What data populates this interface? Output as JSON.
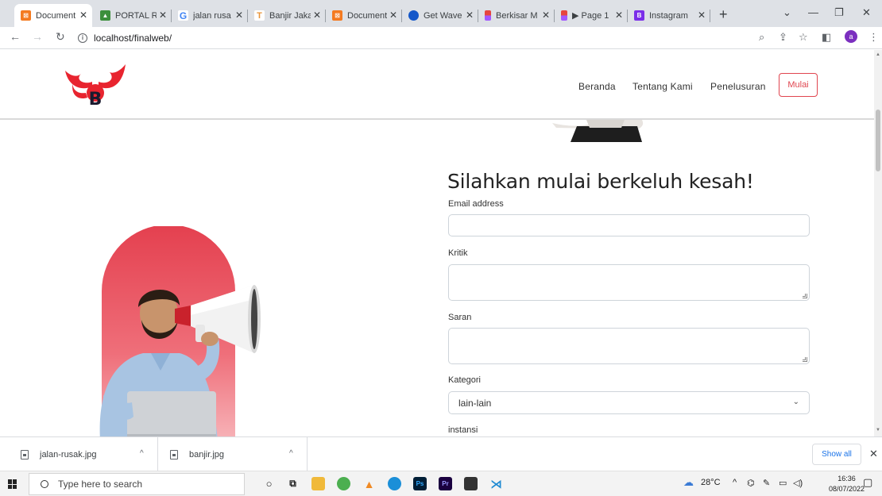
{
  "browser": {
    "tabs": [
      {
        "title": "Document",
        "icon": "xampp-icon",
        "color": "#f47a20",
        "active": true
      },
      {
        "title": "PORTAL R",
        "icon": "portal-icon",
        "color": "#3c8f3c"
      },
      {
        "title": "jalan rusa",
        "icon": "google-icon",
        "color": "#4285f4"
      },
      {
        "title": "Banjir Jaka",
        "icon": "t-icon",
        "color": "#e9953a"
      },
      {
        "title": "Document",
        "icon": "xampp-icon",
        "color": "#f47a20"
      },
      {
        "title": "Get Wave",
        "icon": "wave-icon",
        "color": "#1457c9"
      },
      {
        "title": "Berkisar M",
        "icon": "figma-icon",
        "color": "#e6463e"
      },
      {
        "title": "▶ Page 1",
        "icon": "figma-icon",
        "color": "#e6463e"
      },
      {
        "title": "Instagram",
        "icon": "bootstrap-icon",
        "color": "#7b2ee9"
      }
    ],
    "address": "localhost/finalweb/",
    "profile_initial": "a"
  },
  "site": {
    "nav": {
      "items": [
        "Beranda",
        "Tentang Kami",
        "Penelusuran"
      ],
      "cta": "Mulai"
    },
    "accent_color": "#e0454f",
    "form": {
      "title": "Silahkan mulai berkeluh kesah!",
      "email_label": "Email address",
      "kritik_label": "Kritik",
      "saran_label": "Saran",
      "kategori_label": "Kategori",
      "kategori_value": "lain-lain",
      "instansi_label": "instansi"
    }
  },
  "downloads": {
    "items": [
      {
        "name": "jalan-rusak.jpg"
      },
      {
        "name": "banjir.jpg"
      }
    ],
    "show_all": "Show all"
  },
  "taskbar": {
    "search_placeholder": "Type here to search",
    "weather": "28°C",
    "time": "16:36",
    "date": "08/07/2022"
  }
}
